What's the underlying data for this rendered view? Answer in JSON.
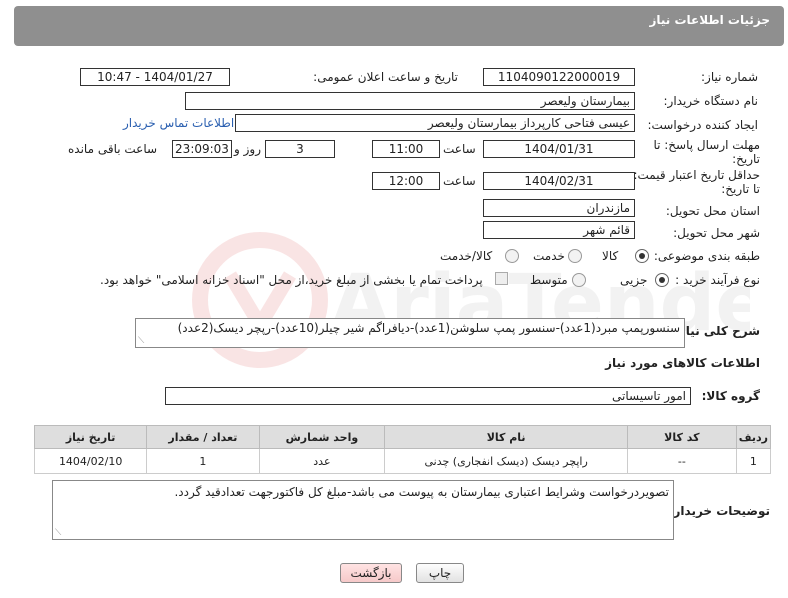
{
  "header": {
    "title": "جزئیات اطلاعات نیاز"
  },
  "form": {
    "need_number_label": "شماره نیاز:",
    "need_number": "1104090122000019",
    "announce_label": "تاریخ و ساعت اعلان عمومی:",
    "announce_value": "1404/01/27 - 10:47",
    "buyer_org_label": "نام دستگاه خریدار:",
    "buyer_org": "بیمارستان ولیعصر",
    "creator_label": "ایجاد کننده درخواست:",
    "creator": "عیسی فتاحی کارپرداز بیمارستان ولیعصر",
    "contact_link": "اطلاعات تماس خریدار",
    "deadline_label_1": "مهلت ارسال پاسخ: تا",
    "deadline_label_2": "تاریخ:",
    "deadline_date": "1404/01/31",
    "time_label": "ساعت",
    "deadline_time": "11:00",
    "days_value": "3",
    "days_label": "روز و",
    "remaining_time": "23:09:03",
    "remaining_label": "ساعت باقی مانده",
    "min_validity_label_1": "حداقل تاریخ اعتبار قیمت:",
    "min_validity_label_2": "تا تاریخ:",
    "validity_date": "1404/02/31",
    "validity_time": "12:00",
    "province_label": "استان محل تحویل:",
    "province": "مازندران",
    "city_label": "شهر محل تحویل:",
    "city": "قائم شهر",
    "category_label": "طبقه بندی موضوعی:",
    "category_options": [
      "کالا",
      "خدمت",
      "کالا/خدمت"
    ],
    "process_label": "نوع فرآیند خرید :",
    "process_options": [
      "جزیی",
      "متوسط"
    ],
    "payment_note": "پرداخت تمام یا بخشی از مبلغ خرید،از محل \"اسناد خزانه اسلامی\" خواهد بود."
  },
  "description": {
    "label": "شرح کلی نیاز:",
    "text": "سنسورپمپ مبرد(1عدد)-سنسور پمپ سلوشن(1عدد)-دیافراگم شیر چیلر(10عدد)-رپچر دیسک(2عدد)"
  },
  "goods": {
    "section_title": "اطلاعات کالاهای مورد نیاز",
    "group_label": "گروه کالا:",
    "group_value": "امور تاسیساتی",
    "columns": [
      "ردیف",
      "کد کالا",
      "نام کالا",
      "واحد شمارش",
      "تعداد / مقدار",
      "تاریخ نیاز"
    ],
    "rows": [
      {
        "row": "1",
        "code": "--",
        "name": "راپچر دیسک (دیسک انفجاری) چدنی",
        "unit": "عدد",
        "qty": "1",
        "date": "1404/02/10"
      }
    ]
  },
  "buyer_notes": {
    "label": "توضیحات خریدار:",
    "text": "تصویردرخواست وشرایط اعتباری بیمارستان به پیوست می باشد-مبلغ کل فاکتورجهت تعدادقید گردد."
  },
  "actions": {
    "print_label": "چاپ",
    "back_label": "بازگشت"
  },
  "watermark": {
    "text": "AriaTender.net"
  },
  "colors": {
    "header_bg": "#8f8f8f",
    "link": "#2a5fb0",
    "table_header": "#dedede",
    "back_button": "#f6c9c9"
  }
}
